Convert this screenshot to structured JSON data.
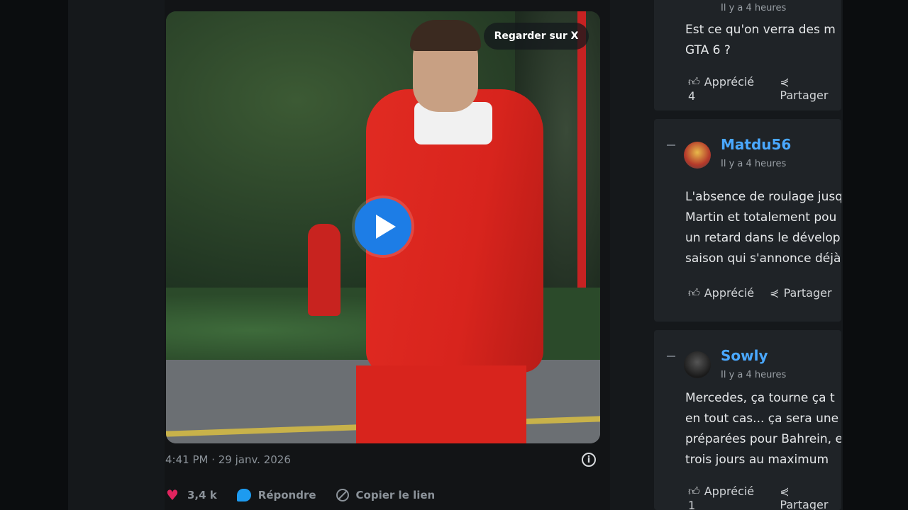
{
  "video": {
    "watch_label": "Regarder sur X"
  },
  "tweet": {
    "timestamp": "4:41 PM · 29 janv. 2026",
    "info_glyph": "i",
    "likes": "3,4 k",
    "reply_label": "Répondre",
    "copy_label": "Copier le lien"
  },
  "comments": [
    {
      "time": "Il y a 4 heures",
      "lines": [
        "Est ce qu'on verra des m",
        "GTA 6 ?"
      ],
      "like_label": "Apprécié 4",
      "share_label": "Partager"
    },
    {
      "user": "Matdu56",
      "time": "Il y a 4 heures",
      "lines": [
        "L'absence de roulage jusq",
        "Martin et totalement pou",
        "un retard dans le dévelop",
        "saison qui s'annonce déjà"
      ],
      "like_label": "Apprécié",
      "share_label": "Partager"
    },
    {
      "user": "Sowly",
      "time": "Il y a 4 heures",
      "lines": [
        "Mercedes, ça tourne ça t",
        "en tout cas... ça sera une",
        "préparées pour Bahrein, e",
        "trois jours au maximum"
      ],
      "like_label": "Apprécié 1",
      "share_label": "Partager"
    }
  ],
  "colors": {
    "accent": "#1d7de6",
    "username": "#4aa8ff",
    "heart": "#e0245e"
  }
}
